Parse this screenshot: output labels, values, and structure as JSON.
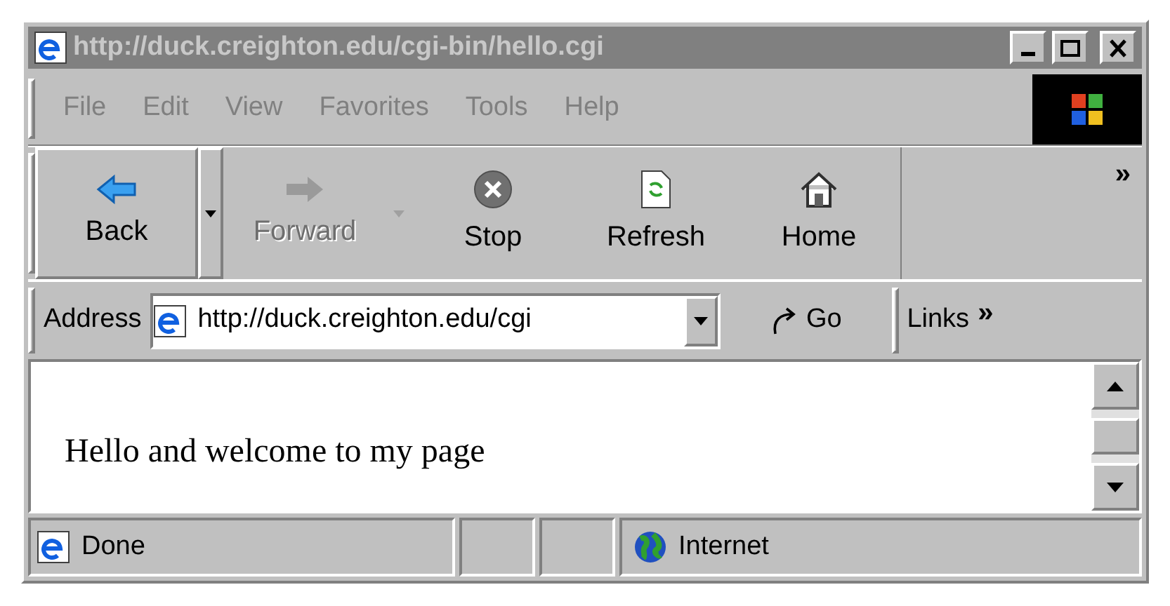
{
  "window": {
    "title": "http://duck.creighton.edu/cgi-bin/hello.cgi",
    "active": false
  },
  "menu": [
    {
      "label": "File"
    },
    {
      "label": "Edit"
    },
    {
      "label": "View"
    },
    {
      "label": "Favorites"
    },
    {
      "label": "Tools"
    },
    {
      "label": "Help"
    }
  ],
  "toolbar": {
    "buttons": [
      {
        "label": "Back",
        "kind": "back",
        "disabled": false,
        "dropdown": true
      },
      {
        "label": "Forward",
        "kind": "forward",
        "disabled": true,
        "dropdown": true
      },
      {
        "label": "Stop",
        "kind": "stop",
        "disabled": false,
        "dropdown": false
      },
      {
        "label": "Refresh",
        "kind": "refresh",
        "disabled": false,
        "dropdown": false
      },
      {
        "label": "Home",
        "kind": "home",
        "disabled": false,
        "dropdown": false
      }
    ],
    "more": "»"
  },
  "address_bar": {
    "label": "Address",
    "value": "http://duck.creighton.edu/cgi",
    "go": "Go",
    "links": "Links",
    "more": "»"
  },
  "content": {
    "text": "Hello and welcome to my page"
  },
  "status_bar": {
    "status": "Done",
    "zone": "Internet"
  }
}
